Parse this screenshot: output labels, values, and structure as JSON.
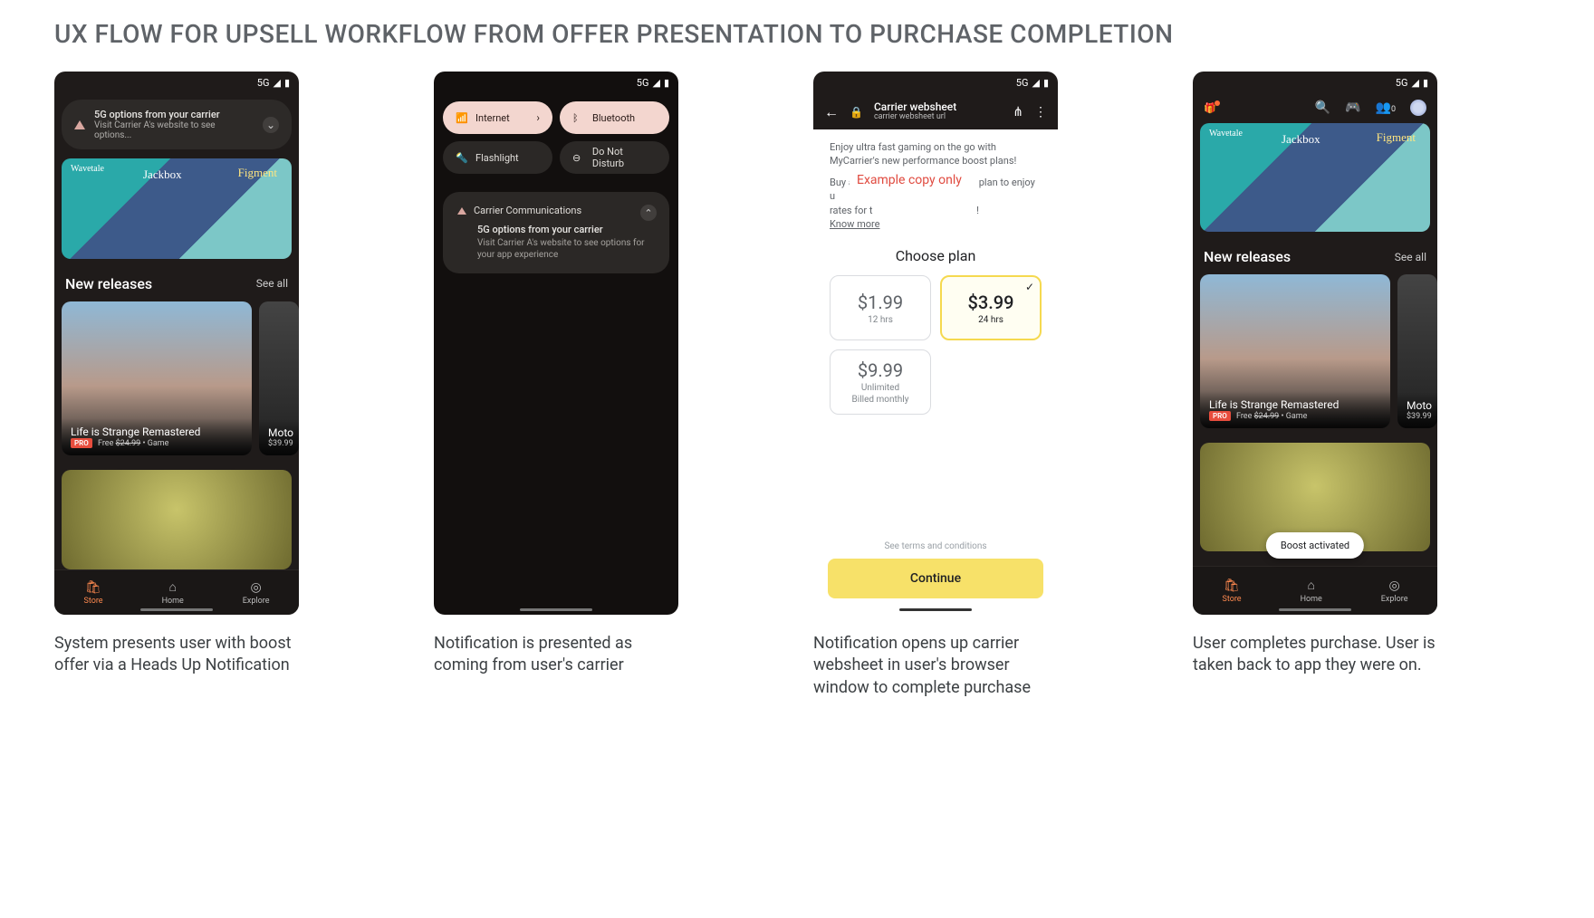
{
  "title": "UX FLOW FOR UPSELL WORKFLOW FROM OFFER PRESENTATION TO PURCHASE COMPLETION",
  "status": {
    "network": "5G"
  },
  "captions": {
    "c1": "System presents user with boost offer via a Heads Up Notification",
    "c2": "Notification is presented as coming from user's carrier",
    "c3": "Notification opens up carrier websheet in user's browser window to complete purchase",
    "c4": "User completes purchase. User is taken back to app they were on."
  },
  "hun": {
    "title": "5G options from your carrier",
    "body": "Visit Carrier A's website to see options..."
  },
  "banner": {
    "g1": "Wavetale",
    "g2": "Jackbox",
    "g3": "Figment"
  },
  "section": {
    "heading": "New releases",
    "seeall": "See all"
  },
  "card1": {
    "title": "Life is Strange Remastered",
    "pro": "PRO",
    "free": "Free",
    "strike": "$24.99",
    "dot": "•",
    "cat": "Game"
  },
  "card2": {
    "title": "Moto",
    "price": "$39.99"
  },
  "nav": {
    "store": "Store",
    "home": "Home",
    "explore": "Explore"
  },
  "qs": {
    "internet": "Internet",
    "bluetooth": "Bluetooth",
    "flashlight": "Flashlight",
    "dnd": "Do Not Disturb"
  },
  "notif": {
    "app": "Carrier Communications",
    "title": "5G options from your carrier",
    "body": "Visit Carrier A's website to see options for your app experience"
  },
  "websheet": {
    "title": "Carrier websheet",
    "url": "carrier websheet url",
    "p1": "Enjoy ultra fast gaming on the go with MyCarrier's new performance boost plans!",
    "p2a": "Buy a pas",
    "p2b": " plan to enjoy u",
    "p2c": "rates for t",
    "p2d": "!",
    "know": "Know more",
    "example": "Example copy only",
    "choose": "Choose plan",
    "plans": [
      {
        "price": "$1.99",
        "duration": "12 hrs",
        "selected": false
      },
      {
        "price": "$3.99",
        "duration": "24 hrs",
        "selected": true
      },
      {
        "price": "$9.99",
        "duration": "Unlimited",
        "sub": "Billed monthly",
        "selected": false
      }
    ],
    "terms": "See terms and conditions",
    "continue": "Continue"
  },
  "friends_count": "0",
  "toast": "Boost activated"
}
